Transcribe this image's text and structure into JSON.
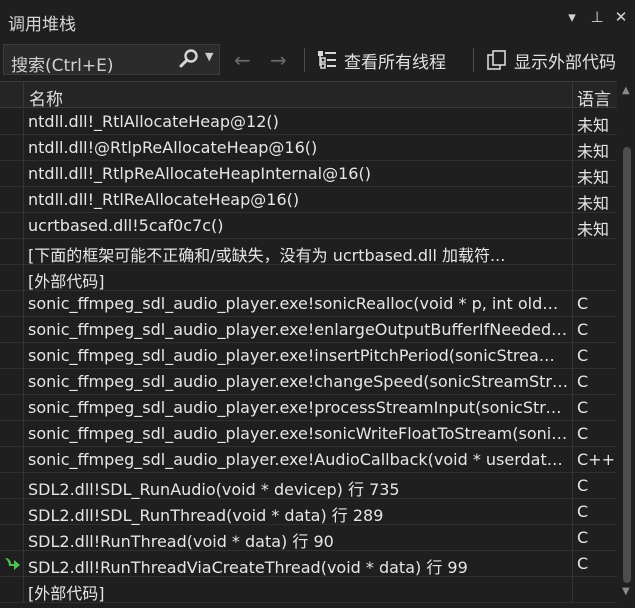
{
  "window": {
    "title": "调用堆栈",
    "dropdown_glyph": "▾",
    "pin_glyph": "⊥",
    "close_glyph": "✕"
  },
  "toolbar": {
    "search_placeholder": "搜索(Ctrl+E)",
    "back_glyph": "←",
    "forward_glyph": "→",
    "view_threads_label": "查看所有线程",
    "show_external_label": "显示外部代码"
  },
  "columns": {
    "name": "名称",
    "language": "语言"
  },
  "frames": [
    {
      "name": "ntdll.dll!_RtlAllocateHeap@12()",
      "language": "未知"
    },
    {
      "name": "ntdll.dll!@RtlpReAllocateHeap@16()",
      "language": "未知"
    },
    {
      "name": "ntdll.dll!_RtlpReAllocateHeapInternal@16()",
      "language": "未知"
    },
    {
      "name": "ntdll.dll!_RtlReAllocateHeap@16()",
      "language": "未知"
    },
    {
      "name": "ucrtbased.dll!5caf0c7c()",
      "language": "未知"
    },
    {
      "name": "[下面的框架可能不正确和/或缺失，没有为 ucrtbased.dll 加载符...",
      "language": ""
    },
    {
      "name": "[外部代码]",
      "language": ""
    },
    {
      "name": "sonic_ffmpeg_sdl_audio_player.exe!sonicRealloc(void * p, int oldNu...",
      "language": "C"
    },
    {
      "name": "sonic_ffmpeg_sdl_audio_player.exe!enlargeOutputBufferIfNeeded(s...",
      "language": "C"
    },
    {
      "name": "sonic_ffmpeg_sdl_audio_player.exe!insertPitchPeriod(sonicStreamSt...",
      "language": "C"
    },
    {
      "name": "sonic_ffmpeg_sdl_audio_player.exe!changeSpeed(sonicStreamStruc...",
      "language": "C"
    },
    {
      "name": "sonic_ffmpeg_sdl_audio_player.exe!processStreamInput(sonicStrea...",
      "language": "C"
    },
    {
      "name": "sonic_ffmpeg_sdl_audio_player.exe!sonicWriteFloatToStream(sonicS...",
      "language": "C"
    },
    {
      "name": "sonic_ffmpeg_sdl_audio_player.exe!AudioCallback(void * userdata, ...",
      "language": "C++"
    },
    {
      "name": "SDL2.dll!SDL_RunAudio(void * devicep) 行 735",
      "language": "C"
    },
    {
      "name": "SDL2.dll!SDL_RunThread(void * data) 行 289",
      "language": "C"
    },
    {
      "name": "SDL2.dll!RunThread(void * data) 行 90",
      "language": "C"
    },
    {
      "name": "SDL2.dll!RunThreadViaCreateThread(void * data) 行 99",
      "language": "C",
      "marker": "current-frame-arrow-icon"
    },
    {
      "name": "[外部代码]",
      "language": ""
    }
  ],
  "colors": {
    "background": "#1f1f1f",
    "current_frame_arrow": "#4ec24e"
  }
}
